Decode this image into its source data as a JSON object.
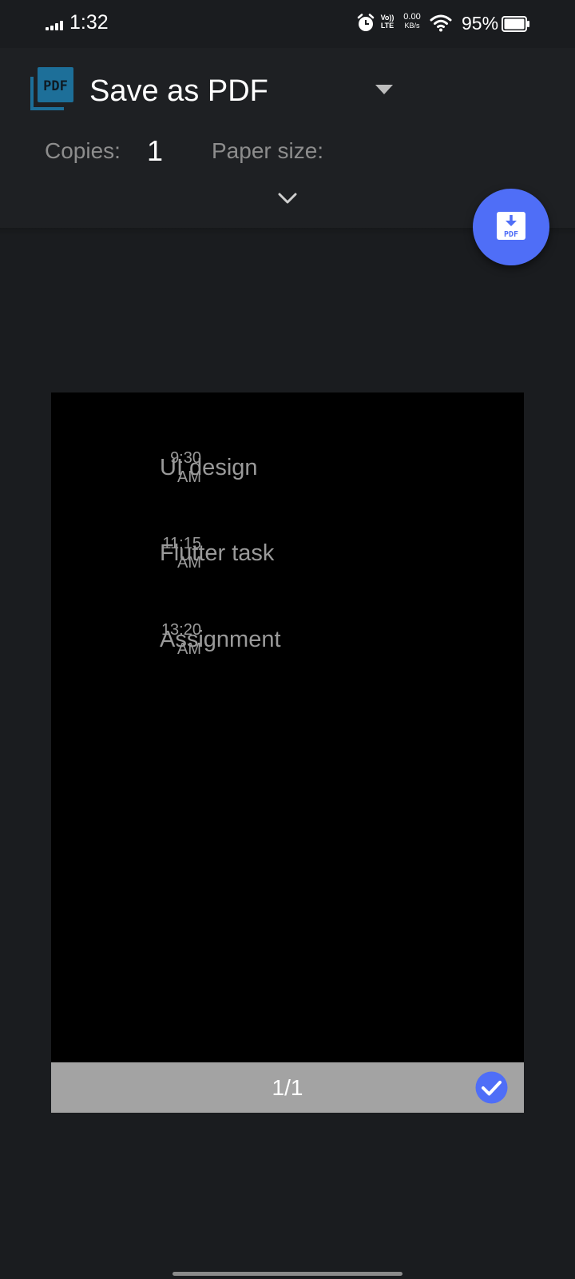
{
  "status_bar": {
    "time": "1:32",
    "lte_top": "Vo))",
    "lte_bottom": "LTE",
    "speed_value": "0.00",
    "speed_unit": "KB/s",
    "battery": "95%"
  },
  "header": {
    "printer": "Save as PDF",
    "copies_label": "Copies:",
    "copies_value": "1",
    "paper_size_label": "Paper size:"
  },
  "fab": {
    "icon": "pdf-download-icon"
  },
  "preview": {
    "tasks": [
      {
        "time_line1": "9:30",
        "time_line2": "AM",
        "name": "UI design"
      },
      {
        "time_line1": "11:15",
        "time_line2": "AM",
        "name": "Flutter task"
      },
      {
        "time_line1": "13:20",
        "time_line2": "AM",
        "name": "Assignment"
      }
    ],
    "page_indicator": "1/1"
  },
  "colors": {
    "background": "#1a1c1f",
    "header": "#1e2023",
    "accent": "#4f6ef7",
    "pdf_logo": "#1d6f99",
    "page_bar": "#a3a3a3"
  }
}
